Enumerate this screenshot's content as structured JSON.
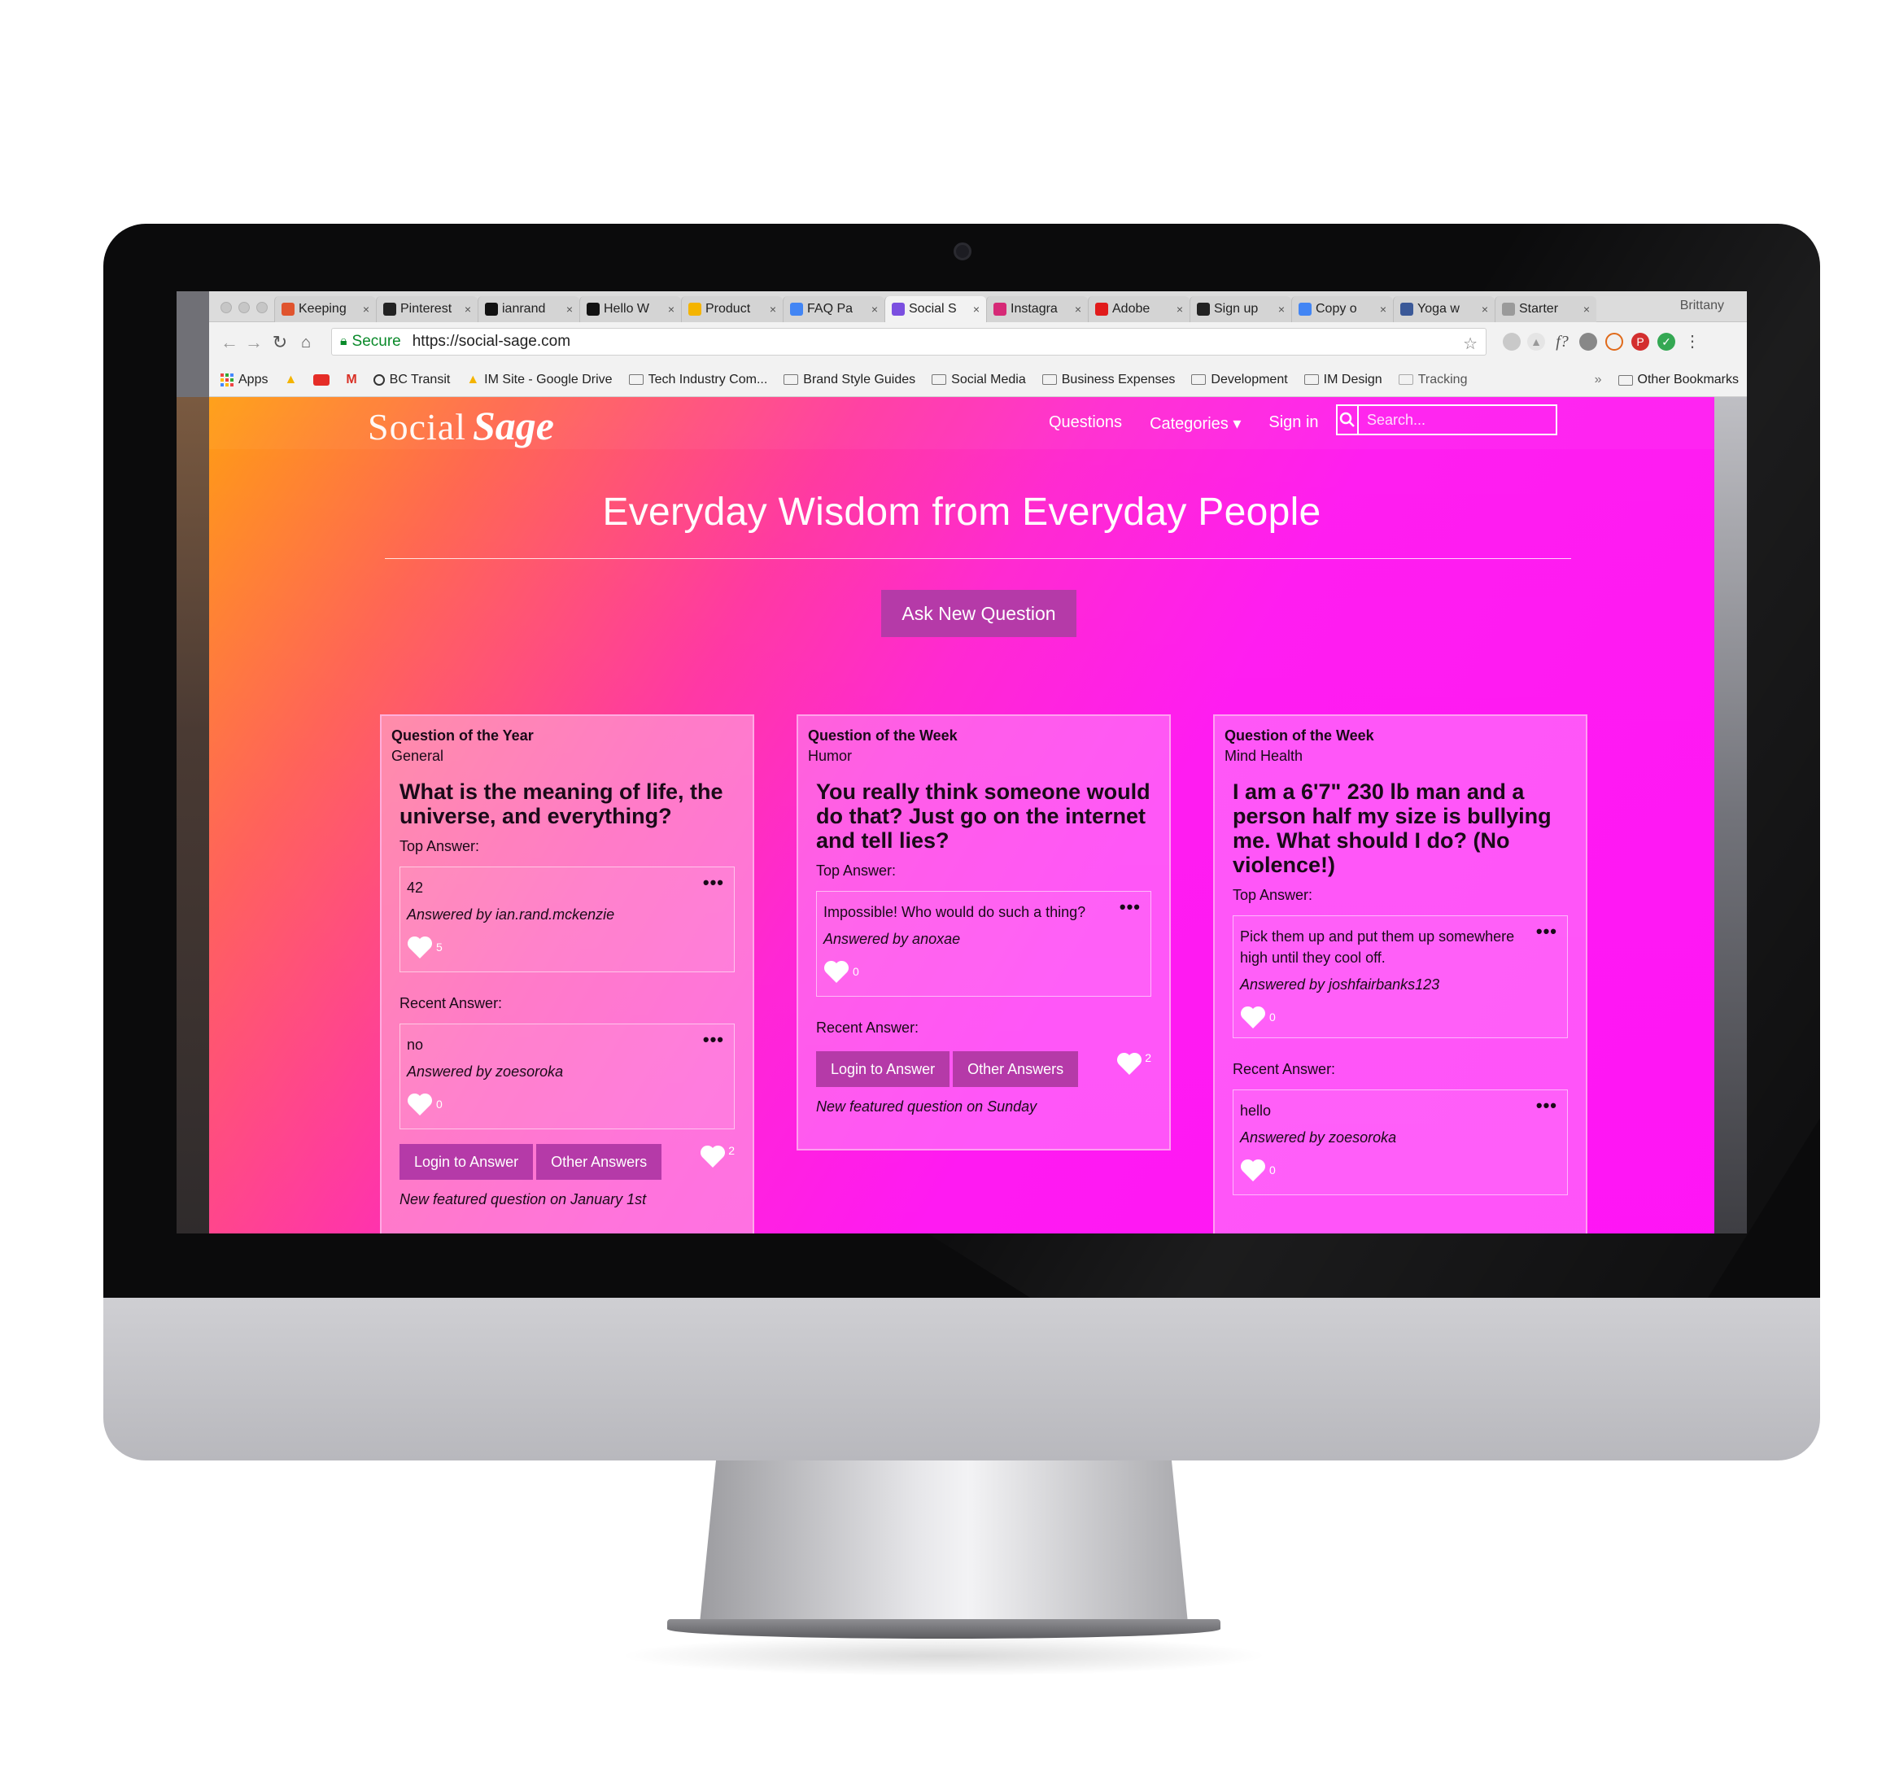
{
  "browser": {
    "tabs": [
      {
        "title": "Keeping",
        "color": "#e0542e"
      },
      {
        "title": "Pinterest",
        "color": "#222222"
      },
      {
        "title": "ianrand",
        "color": "#111111"
      },
      {
        "title": "Hello W",
        "color": "#111111"
      },
      {
        "title": "Product",
        "color": "#f4b400"
      },
      {
        "title": "FAQ Pa",
        "color": "#4285f4"
      },
      {
        "title": "Social S",
        "color": "#7b4fe0"
      },
      {
        "title": "Instagra",
        "color": "#d62976"
      },
      {
        "title": "Adobe",
        "color": "#e11b1b"
      },
      {
        "title": "Sign up",
        "color": "#222222"
      },
      {
        "title": "Copy o",
        "color": "#4285f4"
      },
      {
        "title": "Yoga w",
        "color": "#3b5998"
      },
      {
        "title": "Starter",
        "color": "#9a9a9a"
      }
    ],
    "active_tab_index": 6,
    "profile_name": "Brittany",
    "secure_label": "Secure",
    "url": "https://social-sage.com",
    "bookmarks": [
      "Apps",
      "",
      "",
      "",
      "BC Transit",
      "IM Site - Google Drive",
      "Tech Industry Com...",
      "Brand Style Guides",
      "Social Media",
      "Business Expenses",
      "Development",
      "IM Design",
      "Tracking"
    ],
    "bookmark_labels": {
      "apps": "Apps",
      "bc_transit": "BC Transit",
      "im_site": "IM Site - Google Drive",
      "tech": "Tech Industry Com...",
      "brand": "Brand Style Guides",
      "social": "Social Media",
      "business": "Business Expenses",
      "development": "Development",
      "im_design": "IM Design",
      "tracking": "Tracking"
    },
    "other_bookmarks": "Other Bookmarks",
    "overflow_glyph": "»"
  },
  "site": {
    "logo_part1": "Social",
    "logo_part2": "Sage",
    "nav": {
      "questions": "Questions",
      "categories": "Categories ▾",
      "signin": "Sign in"
    },
    "search_placeholder": "Search...",
    "hero_title": "Everyday Wisdom from Everyday People",
    "ask_button": "Ask New Question",
    "accent_color": "#b53aa8",
    "cards": [
      {
        "kicker": "Question of the Year",
        "category": "General",
        "question": "What is the meaning of life, the universe, and everything?",
        "top_label": "Top Answer:",
        "top_answer": {
          "text": "42",
          "by": "Answered by ian.rand.mckenzie",
          "likes": "5"
        },
        "recent_label": "Recent Answer:",
        "recent_answer": {
          "text": "no",
          "by": "Answered by zoesoroka",
          "likes": "0"
        },
        "login_button": "Login to Answer",
        "other_button": "Other Answers",
        "question_likes": "2",
        "featured_note": "New featured question on January 1st"
      },
      {
        "kicker": "Question of the Week",
        "category": "Humor",
        "question": "You really think someone would do that? Just go on the internet and tell lies?",
        "top_label": "Top Answer:",
        "top_answer": {
          "text": "Impossible! Who would do such a thing?",
          "by": "Answered by anoxae",
          "likes": "0"
        },
        "recent_label": "Recent Answer:",
        "login_button": "Login to Answer",
        "other_button": "Other Answers",
        "question_likes": "2",
        "featured_note": "New featured question on Sunday"
      },
      {
        "kicker": "Question of the Week",
        "category": "Mind Health",
        "question": "I am a 6'7\" 230 lb man and a person half my size is bullying me. What should I do? (No violence!)",
        "top_label": "Top Answer:",
        "top_answer": {
          "text": "Pick them up and put them up somewhere high until they cool off.",
          "by": "Answered by joshfairbanks123",
          "likes": "0"
        },
        "recent_label": "Recent Answer:",
        "recent_answer": {
          "text": "hello",
          "by": "Answered by zoesoroka",
          "likes": "0"
        }
      }
    ],
    "more_glyph": "•••"
  }
}
